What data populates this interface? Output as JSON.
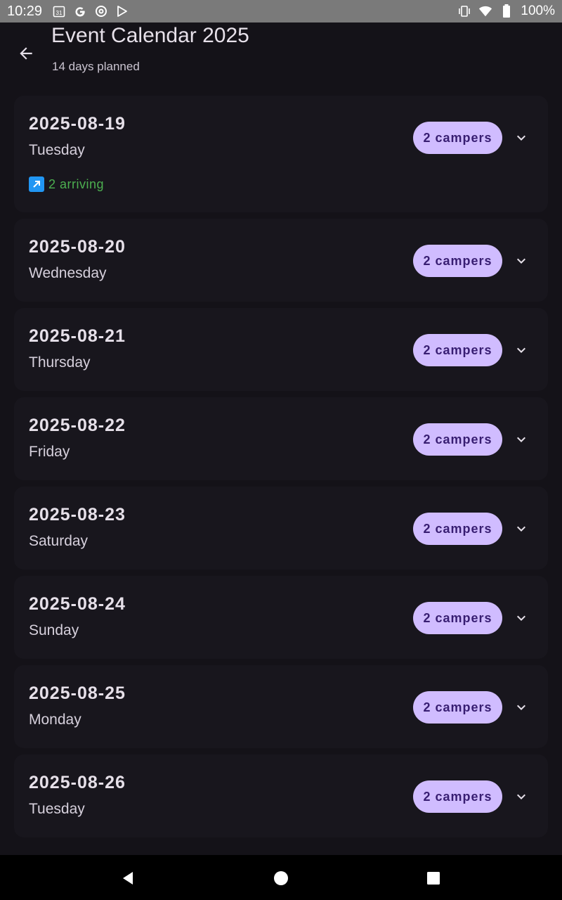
{
  "status_bar": {
    "time": "10:29",
    "left_icons": [
      "calendar-icon",
      "google-icon",
      "at-sign-icon",
      "play-store-icon"
    ],
    "right_icons": [
      "vibrate-icon",
      "wifi-icon",
      "battery-icon"
    ],
    "battery": "100%"
  },
  "header": {
    "title": "Event Calendar 2025",
    "subtitle": "14 days planned"
  },
  "days": [
    {
      "date": "2025-08-19",
      "weekday": "Tuesday",
      "campers": "2 campers",
      "arriving": "2 arriving"
    },
    {
      "date": "2025-08-20",
      "weekday": "Wednesday",
      "campers": "2 campers"
    },
    {
      "date": "2025-08-21",
      "weekday": "Thursday",
      "campers": "2 campers"
    },
    {
      "date": "2025-08-22",
      "weekday": "Friday",
      "campers": "2 campers"
    },
    {
      "date": "2025-08-23",
      "weekday": "Saturday",
      "campers": "2 campers"
    },
    {
      "date": "2025-08-24",
      "weekday": "Sunday",
      "campers": "2 campers"
    },
    {
      "date": "2025-08-25",
      "weekday": "Monday",
      "campers": "2 campers"
    },
    {
      "date": "2025-08-26",
      "weekday": "Tuesday",
      "campers": "2 campers"
    }
  ],
  "colors": {
    "background": "#141218",
    "card": "#18161d",
    "chip": "#d0bcff",
    "chip_text": "#381e72",
    "arriving": "#4caf50"
  }
}
